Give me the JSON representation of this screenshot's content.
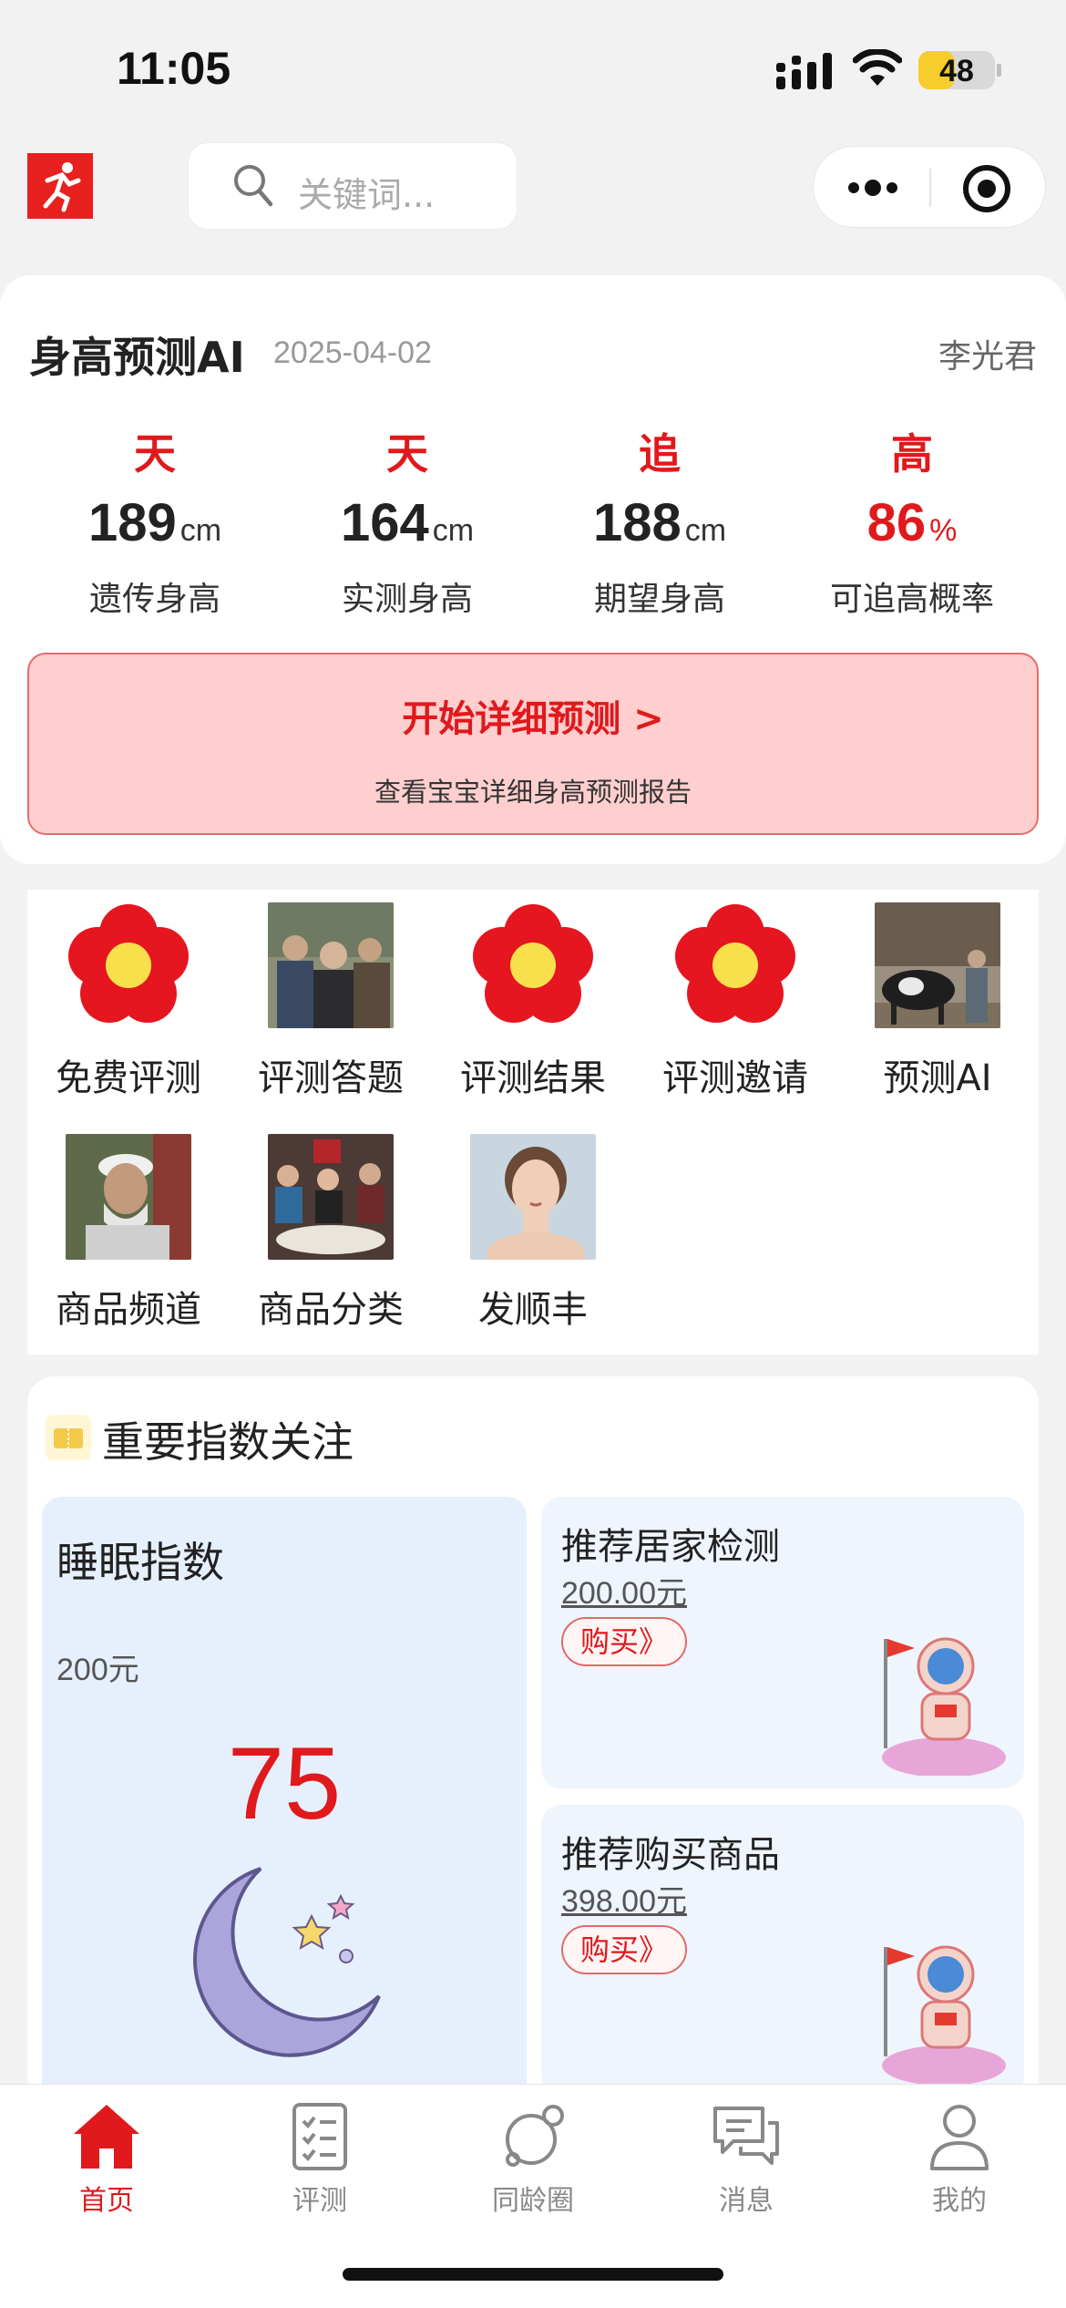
{
  "status_bar": {
    "time": "11:05",
    "battery": "48",
    "battery_level": 0.48
  },
  "nav": {
    "logo_icon": "runner-logo-icon",
    "search_placeholder": "关键词...",
    "more_icon": "more-dots-icon",
    "target_icon": "record-target-icon"
  },
  "prediction": {
    "title": "身高预测AI",
    "date": "2025-04-02",
    "user": "李光君",
    "stats": [
      {
        "tag": "天",
        "value": "189",
        "unit": "cm",
        "label": "遗传身高"
      },
      {
        "tag": "天",
        "value": "164",
        "unit": "cm",
        "label": "实测身高"
      },
      {
        "tag": "追",
        "value": "188",
        "unit": "cm",
        "label": "期望身高"
      },
      {
        "tag": "高",
        "value": "86",
        "unit": "%",
        "label": "可追高概率"
      }
    ],
    "start_button": "开始详细预测 >",
    "start_subtitle": "查看宝宝详细身高预测报告"
  },
  "menu": [
    {
      "label": "免费评测",
      "icon": "red-flower-icon"
    },
    {
      "label": "评测答题",
      "icon": "photo-elderly-people"
    },
    {
      "label": "评测结果",
      "icon": "red-flower-icon"
    },
    {
      "label": "评测邀请",
      "icon": "red-flower-icon"
    },
    {
      "label": "预测AI",
      "icon": "photo-cow-farm"
    },
    {
      "label": "商品频道",
      "icon": "photo-old-man"
    },
    {
      "label": "商品分类",
      "icon": "photo-family-dinner"
    },
    {
      "label": "发顺丰",
      "icon": "photo-woman-face"
    }
  ],
  "index_section": {
    "title": "重要指数关注",
    "sleep": {
      "title": "睡眠指数",
      "price": "200元",
      "score": "75"
    },
    "recommendations": [
      {
        "title": "推荐居家检测",
        "price": "200.00元",
        "buy": "购买》"
      },
      {
        "title": "推荐购买商品",
        "price": "398.00元",
        "buy": "购买》"
      }
    ]
  },
  "tabbar": [
    {
      "label": "首页",
      "icon": "home-icon",
      "active": true
    },
    {
      "label": "评测",
      "icon": "checklist-icon",
      "active": false
    },
    {
      "label": "同龄圈",
      "icon": "planet-icon",
      "active": false
    },
    {
      "label": "消息",
      "icon": "chat-icon",
      "active": false
    },
    {
      "label": "我的",
      "icon": "user-icon",
      "active": false
    }
  ],
  "colors": {
    "accent": "#e0191c",
    "start_box_bg": "#ffcfcf",
    "sleep_bg": "#e6f0fd",
    "rec_bg": "#eef5fd"
  }
}
